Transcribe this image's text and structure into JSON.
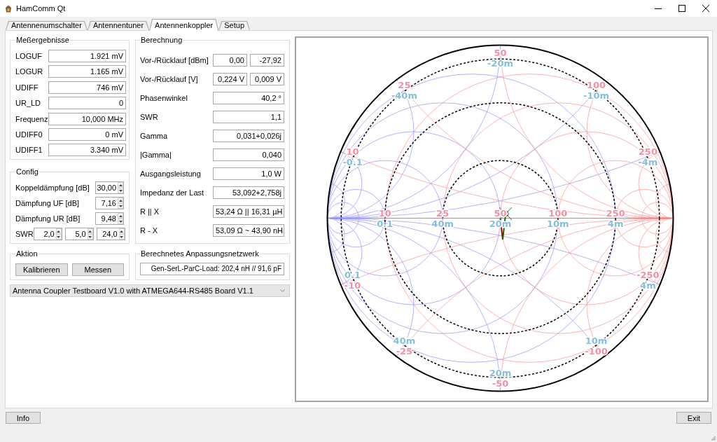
{
  "window": {
    "title": "HamComm Qt"
  },
  "tabs": [
    {
      "label": "Antennenumschalter",
      "selected": false
    },
    {
      "label": "Antennentuner",
      "selected": false
    },
    {
      "label": "Antennenkoppler",
      "selected": true
    },
    {
      "label": "Setup",
      "selected": false
    }
  ],
  "measurements": {
    "title": "Meßergebnisse",
    "rows": [
      {
        "label": "LOGUF",
        "value": "1.921 mV"
      },
      {
        "label": "LOGUR",
        "value": "1.165 mV"
      },
      {
        "label": "UDIFF",
        "value": "746 mV"
      },
      {
        "label": "UR_LD",
        "value": "0"
      },
      {
        "label": "Frequenz",
        "value": "10,000 MHz"
      },
      {
        "label": "UDIFF0",
        "value": "0 mV"
      },
      {
        "label": "UDIFF1",
        "value": "3.340 mV"
      }
    ]
  },
  "config": {
    "title": "Config",
    "rows": [
      {
        "label": "Koppeldämpfung [dB]",
        "values": [
          "30,00"
        ]
      },
      {
        "label": "Dämpfung UF [dB]",
        "values": [
          "7,16"
        ]
      },
      {
        "label": "Dämpfung UR [dB]",
        "values": [
          "9,48"
        ]
      },
      {
        "label": "SWR",
        "values": [
          "2,0",
          "5,0",
          "24,0"
        ]
      }
    ]
  },
  "action": {
    "title": "Aktion",
    "calibrate_button": "Kalibrieren",
    "measure_button": "Messen"
  },
  "calculation": {
    "title": "Berechnung",
    "rows": [
      {
        "label": "Vor-/Rücklauf [dBm]",
        "values": [
          "0,00",
          "-27,92"
        ]
      },
      {
        "label": "Vor-/Rücklauf [V]",
        "values": [
          "0,224 V",
          "0,009 V"
        ]
      },
      {
        "label": "Phasenwinkel",
        "values": [
          "40,2 °"
        ]
      },
      {
        "label": "SWR",
        "values": [
          "1,1"
        ]
      },
      {
        "label": "Gamma",
        "values": [
          "0,031+0,026j"
        ]
      },
      {
        "label": "|Gamma|",
        "values": [
          "0,040"
        ]
      },
      {
        "label": "Ausgangsleistung",
        "values": [
          "1,0 W"
        ]
      },
      {
        "label": "Impedanz der Last",
        "values": [
          "53,092+2,758j"
        ]
      },
      {
        "label": "R || X",
        "values": [
          "53,24 Ω || 16,31 µH"
        ]
      },
      {
        "label": "R - X",
        "values": [
          "53,09 Ω ~ 43,90 nH"
        ]
      }
    ]
  },
  "matching_network": {
    "title": "Berechnetes Anpassungsnetzwerk",
    "value": "Gen-SerL-ParC-Load: 202,4 nH // 91,6 pF"
  },
  "board_select": {
    "value": "Antenna Coupler Testboard V1.0 with ATMEGA644-RS485 Board V1.1"
  },
  "smith_chart": {
    "upper_rim_marks": [
      {
        "labels": [
          {
            "kind": "impedance",
            "text": "50"
          },
          {
            "kind": "admittance",
            "text": "-20m"
          }
        ]
      },
      {
        "labels": [
          {
            "kind": "impedance",
            "text": "25"
          },
          {
            "kind": "admittance",
            "text": "-40m"
          }
        ]
      },
      {
        "labels": [
          {
            "kind": "impedance",
            "text": "100"
          },
          {
            "kind": "admittance",
            "text": "-10m"
          }
        ]
      },
      {
        "labels": [
          {
            "kind": "impedance",
            "text": "10"
          },
          {
            "kind": "admittance",
            "text": "-0.1"
          }
        ]
      },
      {
        "labels": [
          {
            "kind": "impedance",
            "text": "250"
          },
          {
            "kind": "admittance",
            "text": "-4m"
          }
        ]
      }
    ],
    "axis_marks": [
      {
        "labels": [
          {
            "kind": "impedance",
            "text": "10"
          },
          {
            "kind": "admittance",
            "text": "0.1"
          }
        ]
      },
      {
        "labels": [
          {
            "kind": "impedance",
            "text": "25"
          },
          {
            "kind": "admittance",
            "text": "40m"
          }
        ]
      },
      {
        "labels": [
          {
            "kind": "impedance",
            "text": "50"
          },
          {
            "kind": "admittance",
            "text": "20m"
          }
        ]
      },
      {
        "labels": [
          {
            "kind": "impedance",
            "text": "100"
          },
          {
            "kind": "admittance",
            "text": "10m"
          }
        ]
      },
      {
        "labels": [
          {
            "kind": "impedance",
            "text": "250"
          },
          {
            "kind": "admittance",
            "text": "4m"
          }
        ]
      }
    ],
    "lower_rim_marks": [
      {
        "labels": [
          {
            "kind": "admittance",
            "text": "0.1"
          },
          {
            "kind": "impedance",
            "text": "-10"
          }
        ]
      },
      {
        "labels": [
          {
            "kind": "impedance",
            "text": "-250"
          },
          {
            "kind": "admittance",
            "text": "4m"
          }
        ]
      },
      {
        "labels": [
          {
            "kind": "admittance",
            "text": "40m"
          },
          {
            "kind": "impedance",
            "text": "-25"
          }
        ]
      },
      {
        "labels": [
          {
            "kind": "admittance",
            "text": "10m"
          },
          {
            "kind": "impedance",
            "text": "-100"
          }
        ]
      },
      {
        "labels": [
          {
            "kind": "admittance",
            "text": "20m"
          },
          {
            "kind": "impedance",
            "text": "-50"
          }
        ]
      }
    ]
  },
  "footer": {
    "info_button": "Info",
    "exit_button": "Exit"
  }
}
